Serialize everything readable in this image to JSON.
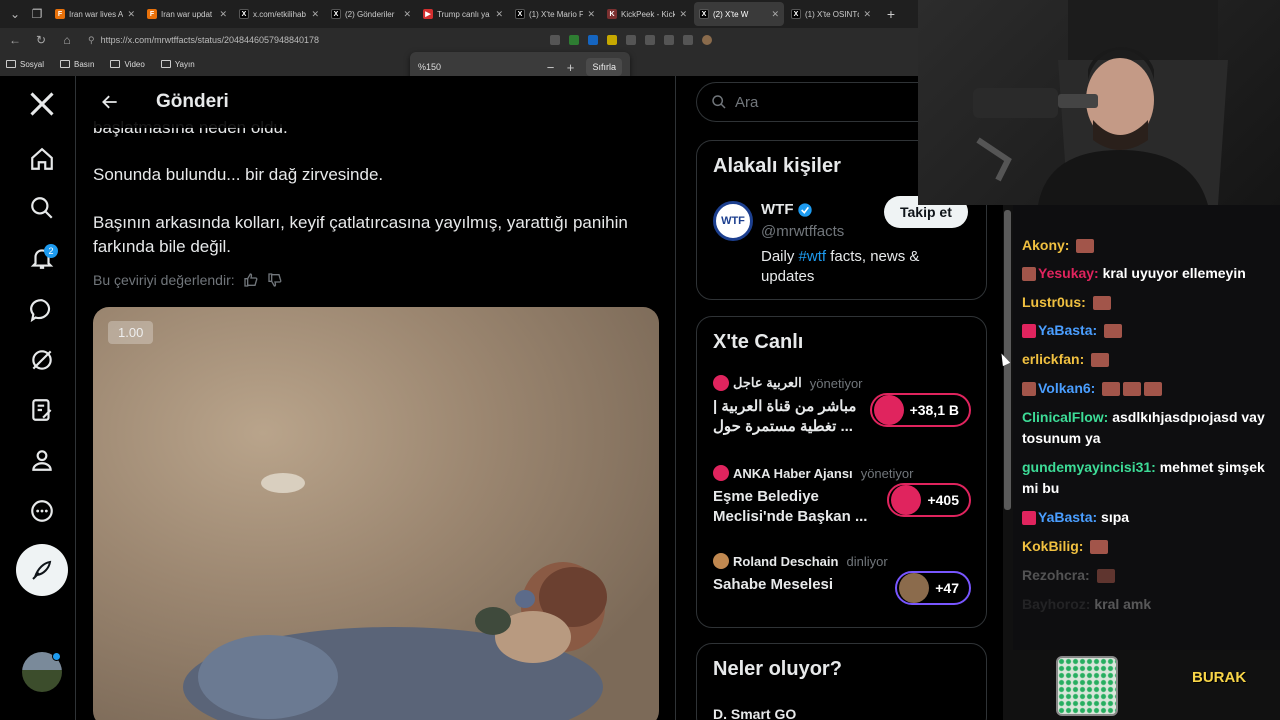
{
  "browser": {
    "tabs": [
      {
        "title": "Iran war lives A",
        "fav_color": "#e8710a",
        "fav": "F"
      },
      {
        "title": "Iran war updat",
        "fav_color": "#e8710a",
        "fav": "F"
      },
      {
        "title": "x.com/etkilihab",
        "fav_color": "#000000",
        "fav": "X"
      },
      {
        "title": "(2) Gönderiler",
        "fav_color": "#000000",
        "fav": "X"
      },
      {
        "title": "Trump canlı ya",
        "fav_color": "#d32f2f",
        "fav": "▶"
      },
      {
        "title": "(1) X'te Mario F",
        "fav_color": "#000000",
        "fav": "X"
      },
      {
        "title": "KickPeek - Kick",
        "fav_color": "#7b3030",
        "fav": "K"
      },
      {
        "title": "(2) X'te W",
        "fav_color": "#000000",
        "fav": "X"
      },
      {
        "title": "(1) X'te OSINTd",
        "fav_color": "#000000",
        "fav": "X"
      }
    ],
    "url": "https://x.com/mrwtffacts/status/2048446057948840178",
    "bookmarks": [
      "Sosyal",
      "Basın",
      "Video",
      "Yayın"
    ],
    "zoom": {
      "level": "%150",
      "reset": "Sıfırla"
    }
  },
  "x": {
    "header_title": "Gönderi",
    "notif_count": "2",
    "tweet_lines": [
      "başlatmasına neden oldu.",
      "Sonunda bulundu... bir dağ zirvesinde.",
      "Başının arkasında kolları, keyif çatlatırcasına yayılmış, yarattığı panihin farkında bile değil."
    ],
    "rate_translation": "Bu çeviriyi değerlendir:",
    "video_speed": "1.00",
    "search_placeholder": "Ara",
    "related": {
      "heading": "Alakalı kişiler",
      "name": "WTF",
      "handle": "@mrwtffacts",
      "bio_pre": "Daily ",
      "bio_tag": "#wtf",
      "bio_post": " facts, news & updates",
      "follow": "Takip et",
      "avatar_text": "WTF"
    },
    "live": {
      "heading": "X'te Canlı",
      "items": [
        {
          "host": "العربية عاجل",
          "role": "yönetiyor",
          "title": "مباشر من قناة العربية | تغطية مستمرة حول ...",
          "count": "+38,1 B",
          "color": "#e0245e"
        },
        {
          "host": "ANKA Haber Ajansı",
          "role": "yönetiyor",
          "title": "Eşme Belediye Meclisi'nde Başkan ...",
          "count": "+405",
          "color": "#e0245e"
        },
        {
          "host": "Roland Deschain",
          "role": "dinliyor",
          "title": "Sahabe Meselesi",
          "count": "+47",
          "color": "#7856ff"
        }
      ]
    },
    "news": {
      "heading": "Neler oluyor?",
      "next": "D. Smart GO"
    }
  },
  "chat": {
    "lines": [
      {
        "user": "Akony:",
        "color": "#f0c040",
        "msg": "",
        "emotes": 1
      },
      {
        "user": "Yesukay:",
        "color": "#e0245e",
        "msg": "kral uyuyor ellemeyin",
        "emotes": 0,
        "badge": "#a2554a"
      },
      {
        "user": "Lustr0us:",
        "color": "#f0c040",
        "msg": "",
        "emotes": 1
      },
      {
        "user": "YaBasta:",
        "color": "#4a9eff",
        "msg": "",
        "emotes": 1,
        "badge": "#e0245e"
      },
      {
        "user": "erlickfan:",
        "color": "#f0c040",
        "msg": "",
        "emotes": 1
      },
      {
        "user": "Volkan6:",
        "color": "#4a9eff",
        "msg": "",
        "emotes": 3,
        "badge": "#a2554a"
      },
      {
        "user": "ClinicalFlow:",
        "color": "#3ddc97",
        "msg": "asdlkıhjasdpıojasd vay tosunum ya",
        "emotes": 0
      },
      {
        "user": "gundemyayincisi31:",
        "color": "#3ddc97",
        "msg": "mehmet şimşek mi bu",
        "emotes": 0
      },
      {
        "user": "YaBasta:",
        "color": "#4a9eff",
        "msg": "sıpa",
        "emotes": 0,
        "badge": "#e0245e"
      },
      {
        "user": "KokBilig:",
        "color": "#f0c040",
        "msg": "",
        "emotes": 1
      },
      {
        "user": "Rezohcra:",
        "color": "#8a8a8a",
        "msg": "",
        "emotes": 1
      },
      {
        "user": "Bayhoroz:",
        "color": "#555555",
        "msg": "kral amk",
        "emotes": 0
      }
    ],
    "banner": "BURAK"
  }
}
